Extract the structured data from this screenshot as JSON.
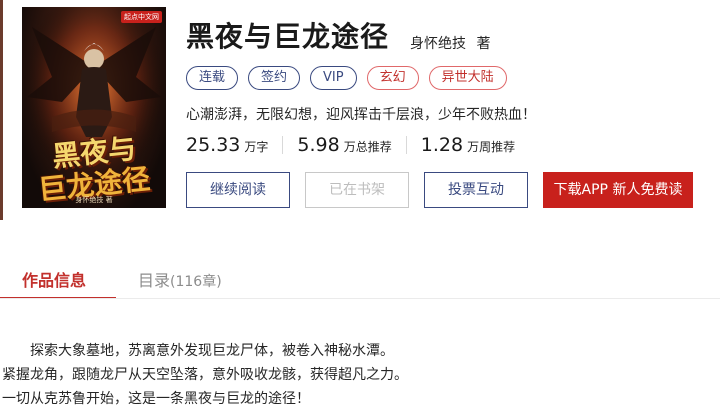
{
  "cover": {
    "badge": "起点中文网",
    "title_line1": "黑夜与",
    "title_line2": "巨龙途径",
    "author_line": "身怀绝技 著"
  },
  "book": {
    "title": "黑夜与巨龙途径",
    "author": "身怀绝技",
    "author_suffix": "著",
    "author_line": "身怀绝技 著",
    "tags": [
      "连载",
      "签约",
      "VIP",
      "玄幻",
      "异世大陆"
    ],
    "slogan": "心潮澎湃，无限幻想，迎风挥击千层浪，少年不败热血！"
  },
  "stats": [
    {
      "value": "25.33",
      "unit": "万字"
    },
    {
      "value": "5.98",
      "unit": "万总推荐"
    },
    {
      "value": "1.28",
      "unit": "万周推荐"
    }
  ],
  "buttons": {
    "read": "继续阅读",
    "shelf": "已在书架",
    "vote": "投票互动",
    "app": "下载APP  新人免费读"
  },
  "tabs": {
    "info": "作品信息",
    "toc": "目录",
    "toc_count": "(116章)"
  },
  "intro": [
    "探索大象墓地，苏离意外发现巨龙尸体，被卷入神秘水潭。",
    "紧握龙角，跟随龙尸从天空坠落，意外吸收龙骸，获得超凡之力。",
    "一切从克苏鲁开始，这是一条黑夜与巨龙的途径！"
  ],
  "colors": {
    "accent_red": "#c8211c",
    "accent_navy": "#3a4a80"
  }
}
